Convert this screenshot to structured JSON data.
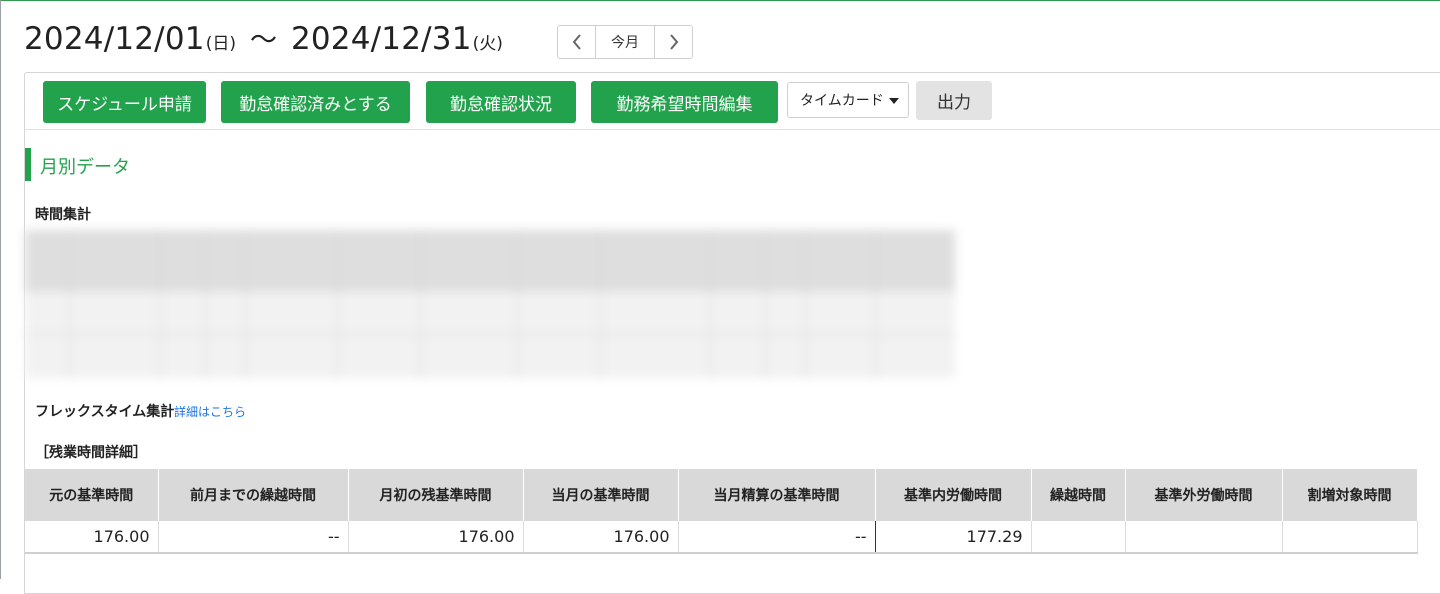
{
  "header": {
    "start_date": "2024/12/01",
    "start_day": "(日)",
    "separator": "〜",
    "end_date": "2024/12/31",
    "end_day": "(火)",
    "prev_icon": "chevron-left-icon",
    "today_label": "今月",
    "next_icon": "chevron-right-icon"
  },
  "toolbar": {
    "buttons": [
      "スケジュール申請",
      "勤怠確認済みとする",
      "勤怠確認状況",
      "勤務希望時間編集"
    ],
    "select_value": "タイムカード",
    "output_label": "出力"
  },
  "section": {
    "title": "月別データ",
    "time_summary_title": "時間集計",
    "flex_title": "フレックスタイム集計",
    "flex_link": "詳細はこちら",
    "overtime_detail_title": "［残業時間詳細］"
  },
  "overtime_table": {
    "headers": [
      "元の基準時間",
      "前月までの繰越時間",
      "月初の残基準時間",
      "当月の基準時間",
      "当月精算の基準時間",
      "基準内労働時間",
      "繰越時間",
      "基準外労働時間",
      "割増対象時間"
    ],
    "row": [
      "176.00",
      "--",
      "176.00",
      "176.00",
      "--",
      "177.29",
      "",
      "",
      ""
    ]
  },
  "colors": {
    "accent_green": "#23a24d",
    "link_blue": "#1a73e8",
    "table_header_bg": "#d9d9d9"
  }
}
